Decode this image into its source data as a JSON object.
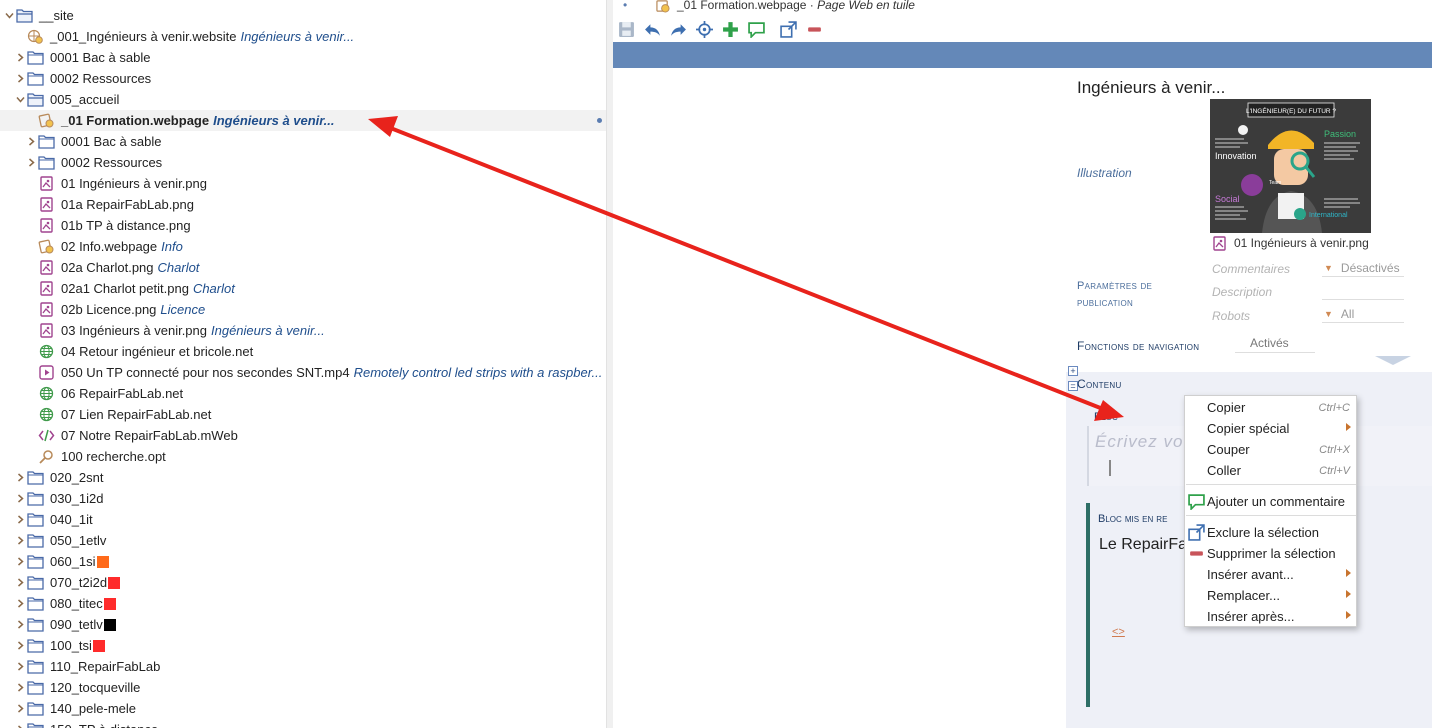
{
  "tree": {
    "items": [
      {
        "level": 0,
        "expanded": true,
        "icon": "folder-open-icon",
        "name": "__site"
      },
      {
        "level": 1,
        "icon": "website-icon",
        "name": "_001_Ingénieurs à venir.website",
        "title": "Ingénieurs à venir..."
      },
      {
        "level": 1,
        "expanded": false,
        "icon": "folder-icon",
        "name": "0001 Bac à sable"
      },
      {
        "level": 1,
        "expanded": false,
        "icon": "folder-icon",
        "name": "0002 Ressources"
      },
      {
        "level": 1,
        "expanded": true,
        "icon": "folder-open-icon",
        "name": "005_accueil"
      },
      {
        "level": 2,
        "icon": "webpage-icon",
        "name": "_01 Formation.webpage",
        "title": "Ingénieurs à venir...",
        "selected": true
      },
      {
        "level": 2,
        "expanded": false,
        "icon": "folder-icon",
        "name": "0001 Bac à sable"
      },
      {
        "level": 2,
        "expanded": false,
        "icon": "folder-icon",
        "name": "0002 Ressources"
      },
      {
        "level": 2,
        "icon": "image-icon",
        "name": "01 Ingénieurs à venir.png"
      },
      {
        "level": 2,
        "icon": "image-icon",
        "name": "01a RepairFabLab.png"
      },
      {
        "level": 2,
        "icon": "image-icon",
        "name": "01b TP à distance.png"
      },
      {
        "level": 2,
        "icon": "webpage-icon",
        "name": "02 Info.webpage",
        "title": "Info"
      },
      {
        "level": 2,
        "icon": "image-icon",
        "name": "02a Charlot.png",
        "title": "Charlot"
      },
      {
        "level": 2,
        "icon": "image-icon",
        "name": "02a1 Charlot petit.png",
        "title": "Charlot"
      },
      {
        "level": 2,
        "icon": "image-icon",
        "name": "02b Licence.png",
        "title": "Licence"
      },
      {
        "level": 2,
        "icon": "image-icon",
        "name": "03 Ingénieurs à venir.png",
        "title": "Ingénieurs à venir..."
      },
      {
        "level": 2,
        "icon": "globe-icon",
        "name": "04 Retour ingénieur et bricole.net"
      },
      {
        "level": 2,
        "icon": "video-icon",
        "name": "050 Un TP connecté pour nos secondes SNT.mp4",
        "title": "Remotely control led strips with a raspber..."
      },
      {
        "level": 2,
        "icon": "globe-icon",
        "name": "06 RepairFabLab.net"
      },
      {
        "level": 2,
        "icon": "globe-icon",
        "name": "07 Lien RepairFabLab.net"
      },
      {
        "level": 2,
        "icon": "code-icon",
        "name": "07 Notre RepairFabLab.mWeb"
      },
      {
        "level": 2,
        "icon": "search-icon",
        "name": "100 recherche.opt"
      },
      {
        "level": 1,
        "expanded": false,
        "icon": "folder-icon",
        "name": "020_2snt"
      },
      {
        "level": 1,
        "expanded": false,
        "icon": "folder-icon",
        "name": "030_1i2d"
      },
      {
        "level": 1,
        "expanded": false,
        "icon": "folder-icon",
        "name": "040_1it"
      },
      {
        "level": 1,
        "expanded": false,
        "icon": "folder-icon",
        "name": "050_1etlv"
      },
      {
        "level": 1,
        "expanded": false,
        "icon": "folder-icon",
        "name": "060_1si",
        "swatch": "#ff6a1a"
      },
      {
        "level": 1,
        "expanded": false,
        "icon": "folder-icon",
        "name": "070_t2i2d",
        "swatch": "#ff2b2b"
      },
      {
        "level": 1,
        "expanded": false,
        "icon": "folder-icon",
        "name": "080_titec",
        "swatch": "#ff2b2b"
      },
      {
        "level": 1,
        "expanded": false,
        "icon": "folder-icon",
        "name": "090_tetlv",
        "swatch": "#000000"
      },
      {
        "level": 1,
        "expanded": false,
        "icon": "folder-icon",
        "name": "100_tsi",
        "swatch": "#ff2b2b"
      },
      {
        "level": 1,
        "expanded": false,
        "icon": "folder-icon",
        "name": "110_RepairFabLab"
      },
      {
        "level": 1,
        "expanded": false,
        "icon": "folder-icon",
        "name": "120_tocqueville"
      },
      {
        "level": 1,
        "expanded": false,
        "icon": "folder-icon",
        "name": "140_pele-mele"
      },
      {
        "level": 1,
        "expanded": false,
        "icon": "folder-icon",
        "name": "150_TP à distance"
      }
    ]
  },
  "tab": {
    "name": "_01 Formation.webpage",
    "kind": "Page Web en tuile"
  },
  "toolbar": {
    "icons": [
      "save-icon",
      "undo-icon",
      "redo-icon",
      "target-icon",
      "add-icon",
      "comment-icon",
      "exclude-icon",
      "remove-icon"
    ]
  },
  "doc": {
    "title": "Ingénieurs à venir...",
    "illustration_label": "Illustration",
    "image_caption": "01 Ingénieurs à venir.png",
    "image_text": {
      "heading": "L'INGÉNIEUR(E) DU FUTUR ?",
      "passion": "Passion",
      "innovation": "Innovation",
      "social": "Social",
      "international": "International",
      "team": "Team"
    },
    "publication_label": "Paramètres de publication",
    "comments_label": "Commentaires",
    "comments_value": "Désactivés",
    "description_label": "Description",
    "robots_label": "Robots",
    "robots_value": "All",
    "navigation_label": "Fonctions de navigation",
    "navigation_value": "Activés",
    "content_label": "Contenu",
    "bloc_label": "Bloc",
    "bloc_placeholder": "Écrivez vo",
    "bloc2_label": "Bloc mis en re",
    "bloc2_text": "Le RepairFal",
    "code_symbol": "<>"
  },
  "context_menu": {
    "items": [
      {
        "label": "Copier",
        "shortcut": "Ctrl+C"
      },
      {
        "label": "Copier spécial",
        "submenu": true
      },
      {
        "label": "Couper",
        "shortcut": "Ctrl+X"
      },
      {
        "label": "Coller",
        "shortcut": "Ctrl+V"
      },
      {
        "label": "Ajouter un commentaire",
        "icon": "comment-icon"
      },
      {
        "label": "Exclure la sélection",
        "icon": "exclude-icon"
      },
      {
        "label": "Supprimer la sélection",
        "icon": "remove-icon"
      },
      {
        "label": "Insérer avant...",
        "submenu": true
      },
      {
        "label": "Remplacer...",
        "submenu": true
      },
      {
        "label": "Insérer après...",
        "submenu": true
      }
    ]
  },
  "colors": {
    "accent_blue": "#6488b8",
    "arrow_red": "#e8231c",
    "content_green": "#2d6e66"
  }
}
